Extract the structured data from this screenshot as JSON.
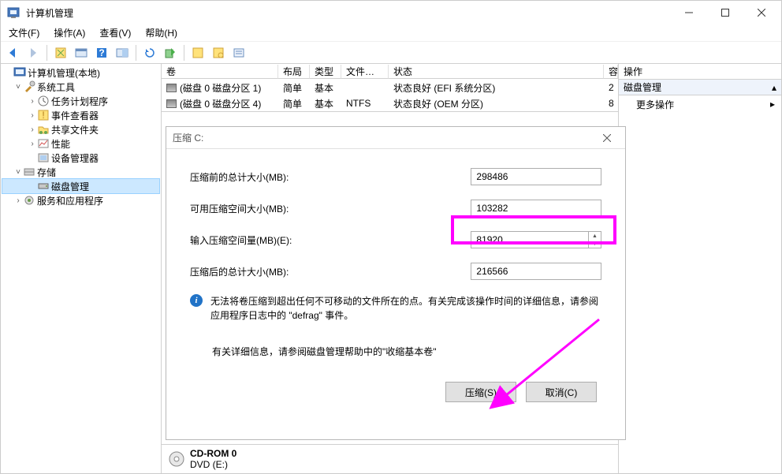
{
  "window": {
    "title": "计算机管理"
  },
  "menubar": {
    "file": "文件(F)",
    "action": "操作(A)",
    "view": "查看(V)",
    "help": "帮助(H)"
  },
  "tree": {
    "root": "计算机管理(本地)",
    "sys_tools": "系统工具",
    "task_sched": "任务计划程序",
    "event_viewer": "事件查看器",
    "shared_folders": "共享文件夹",
    "perf": "性能",
    "dev_mgr": "设备管理器",
    "storage": "存储",
    "disk_mgmt": "磁盘管理",
    "services": "服务和应用程序"
  },
  "grid": {
    "headers": {
      "vol": "卷",
      "layout": "布局",
      "type": "类型",
      "fs": "文件系统",
      "state": "状态",
      "cap": "容"
    },
    "rows": [
      {
        "vol": "(磁盘 0 磁盘分区 1)",
        "layout": "简单",
        "type": "基本",
        "fs": "",
        "state": "状态良好 (EFI 系统分区)",
        "cap": "2"
      },
      {
        "vol": "(磁盘 0 磁盘分区 4)",
        "layout": "简单",
        "type": "基本",
        "fs": "NTFS",
        "state": "状态良好 (OEM 分区)",
        "cap": "8"
      }
    ]
  },
  "bottom": {
    "device": "CD-ROM 0",
    "drive": "DVD (E:)"
  },
  "actions": {
    "title": "操作",
    "section": "磁盘管理",
    "more": "更多操作"
  },
  "dialog": {
    "title": "压缩 C:",
    "before_label": "压缩前的总计大小(MB):",
    "before_value": "298486",
    "avail_label": "可用压缩空间大小(MB):",
    "avail_value": "103282",
    "input_label": "输入压缩空间量(MB)(E):",
    "input_value": "81920",
    "after_label": "压缩后的总计大小(MB):",
    "after_value": "216566",
    "info_text": "无法将卷压缩到超出任何不可移动的文件所在的点。有关完成该操作时间的详细信息，请参阅应用程序日志中的 \"defrag\" 事件。",
    "link_text": "有关详细信息，请参阅磁盘管理帮助中的\"收缩基本卷\"",
    "ok": "压缩(S)",
    "cancel": "取消(C)"
  }
}
